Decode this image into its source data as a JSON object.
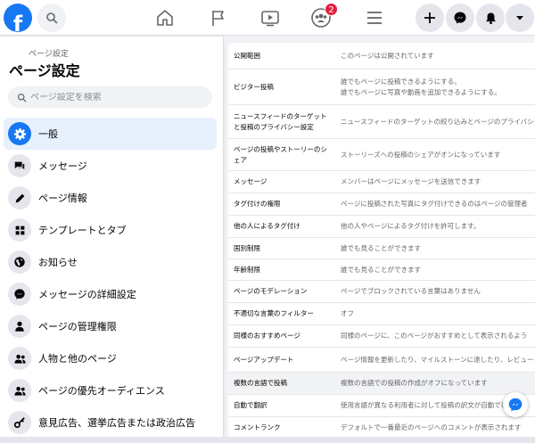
{
  "topbar": {
    "logo_letter": "f",
    "notification_count": "2",
    "nav_icons": [
      "home-icon",
      "flag-icon",
      "watch-icon",
      "groups-icon",
      "menu-icon"
    ],
    "right_icons": [
      "plus-icon",
      "messenger-icon",
      "bell-icon",
      "caret-down-icon"
    ]
  },
  "sidebar": {
    "breadcrumb": "ページ設定",
    "title": "ページ設定",
    "search_placeholder": "ページ設定を検索",
    "items": [
      {
        "label": "一般",
        "icon": "gear-icon",
        "active": true
      },
      {
        "label": "メッセージ",
        "icon": "chat-icon",
        "active": false
      },
      {
        "label": "ページ情報",
        "icon": "pencil-icon",
        "active": false
      },
      {
        "label": "テンプレートとタブ",
        "icon": "grid-icon",
        "active": false
      },
      {
        "label": "お知らせ",
        "icon": "globe-icon",
        "active": false
      },
      {
        "label": "メッセージの詳細設定",
        "icon": "messenger-icon",
        "active": false
      },
      {
        "label": "ページの管理権限",
        "icon": "person-icon",
        "active": false
      },
      {
        "label": "人物と他のページ",
        "icon": "people-icon",
        "active": false
      },
      {
        "label": "ページの優先オーディエンス",
        "icon": "people-icon",
        "active": false
      },
      {
        "label": "意見広告、選挙広告または政治広告",
        "icon": "key-icon",
        "active": false
      }
    ]
  },
  "settings": [
    {
      "name": "公開範囲",
      "value": "このページは公開されています"
    },
    {
      "name": "ビジター投稿",
      "value": "誰でもページに投稿できるようにする。\n誰でもページに写真や動画を追加できるようにする。"
    },
    {
      "name": "ニュースフィードのターゲット\nと投稿のプライバシー設定",
      "value": "ニュースフィードのターゲットの絞り込みとページのプライバシー"
    },
    {
      "name": "ページの投稿やストーリーのシ\nェア",
      "value": "ストーリーズへの投稿のシェアがオンになっています"
    },
    {
      "name": "メッセージ",
      "value": "メンバーはページにメッセージを送信できます"
    },
    {
      "name": "タグ付けの権限",
      "value": "ページに投稿された写真にタグ付けできるのはページの管理者"
    },
    {
      "name": "他の人によるタグ付け",
      "value": "他の人やページによるタグ付けを許可します。"
    },
    {
      "name": "国別制限",
      "value": "誰でも見ることができます"
    },
    {
      "name": "年齢制限",
      "value": "誰でも見ることができます"
    },
    {
      "name": "ページのモデレーション",
      "value": "ページでブロックされている言葉はありません"
    },
    {
      "name": "不適切な言葉のフィルター",
      "value": "オフ"
    },
    {
      "name": "同様のおすすめページ",
      "value": "同様のページに、このページがおすすめとして表示されるよう"
    },
    {
      "name": "ページアップデート",
      "value": "ページ情報を更新したり、マイルストーンに達したり、レビュー"
    },
    {
      "name": "複数の言語で投稿",
      "value": "複数の言語での投稿の作成がオフになっています"
    },
    {
      "name": "自動で翻訳",
      "value": "使用言語が異なる利用者に対して投稿の訳文が自動で表示され"
    },
    {
      "name": "コメントランク",
      "value": "デフォルトで一番最近のページへのコメントが表示されます"
    }
  ],
  "colors": {
    "accent": "#1877f2",
    "badge": "#e41e3f"
  }
}
